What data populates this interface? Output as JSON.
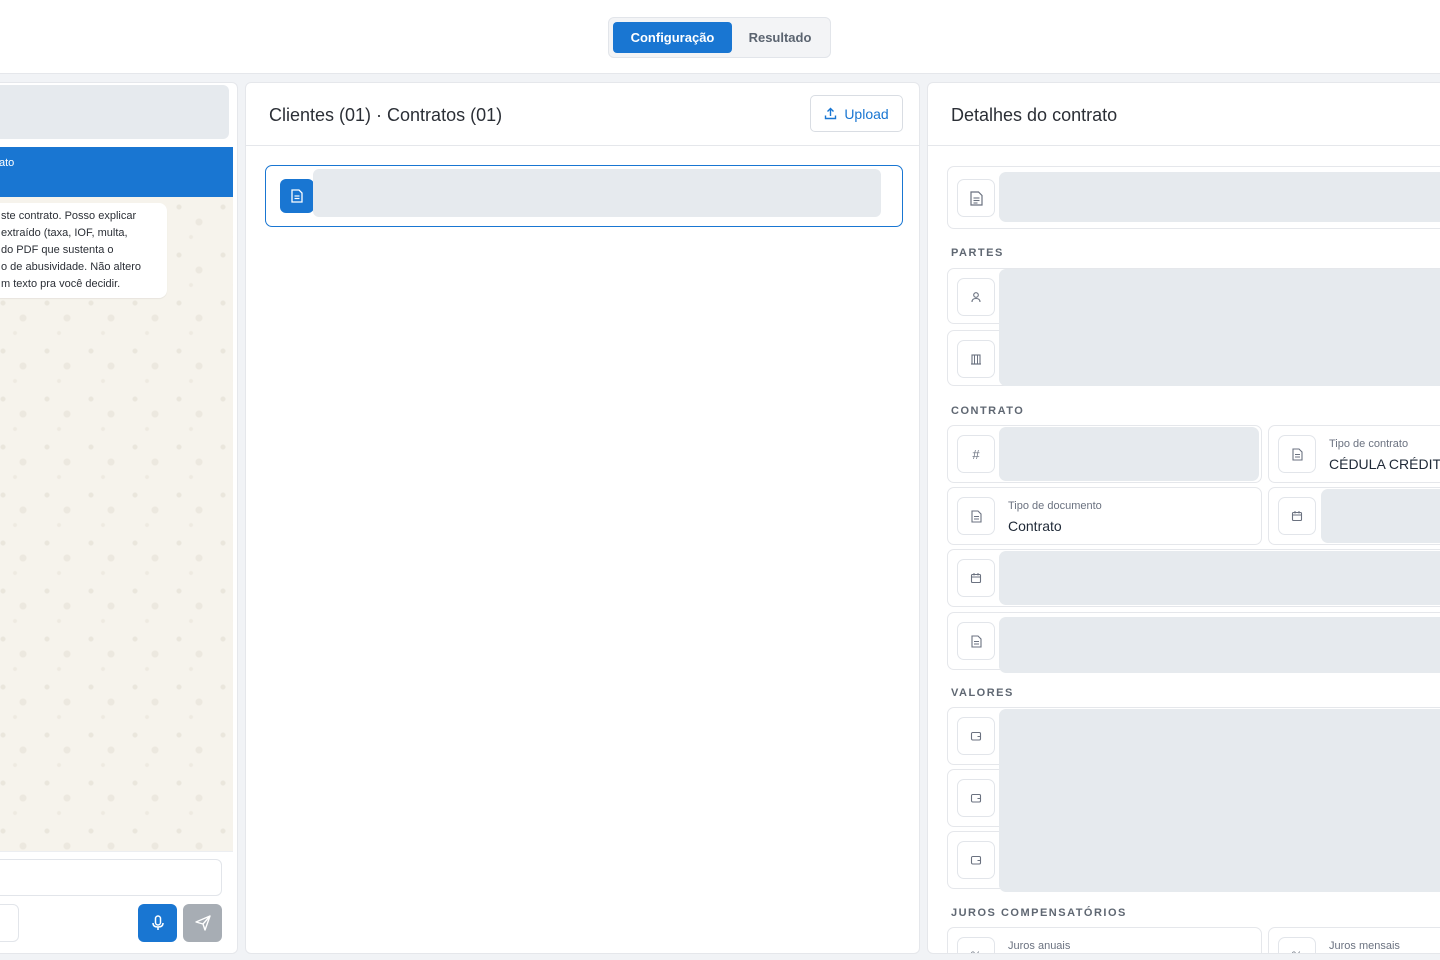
{
  "tabs": {
    "active_label": "Configuração",
    "inactive_label": "Resultado"
  },
  "chat": {
    "header_text": "ato",
    "bubble_text": "ste contrato. Posso explicar\nextraído (taxa, IOF, multa,\ndo PDF que sustenta o\no de abusividade. Não altero\nm texto pra você decidir."
  },
  "contracts_panel": {
    "title": "Clientes (01) · Contratos (01)",
    "upload_label": "Upload"
  },
  "details_panel": {
    "title": "Detalhes do contrato",
    "sections": {
      "partes": "PARTES",
      "contrato": "CONTRATO",
      "valores": "VALORES",
      "juros": "JUROS COMPENSATÓRIOS"
    },
    "fields": {
      "tipo_contrato_label": "Tipo de contrato",
      "tipo_contrato_value": "CÉDULA CRÉDITO",
      "tipo_documento_label": "Tipo de documento",
      "tipo_documento_value": "Contrato",
      "juros_anuais_label": "Juros anuais",
      "juros_mensais_label": "Juros mensais"
    }
  },
  "colors": {
    "accent": "#1976d2",
    "skeleton": "#e6eaee",
    "chat_background": "#f6f3ec"
  }
}
